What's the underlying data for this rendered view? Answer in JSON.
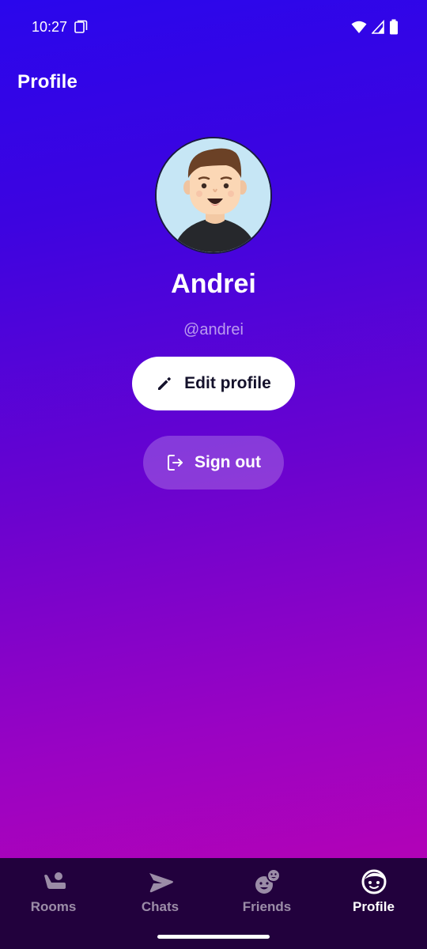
{
  "status_bar": {
    "time": "10:27"
  },
  "header": {
    "title": "Profile"
  },
  "profile": {
    "name": "Andrei",
    "handle": "@andrei"
  },
  "actions": {
    "edit_label": "Edit profile",
    "signout_label": "Sign out"
  },
  "nav": {
    "items": [
      {
        "label": "Rooms",
        "icon": "rooms-icon",
        "active": false
      },
      {
        "label": "Chats",
        "icon": "chats-icon",
        "active": false
      },
      {
        "label": "Friends",
        "icon": "friends-icon",
        "active": false
      },
      {
        "label": "Profile",
        "icon": "profile-icon",
        "active": true
      }
    ]
  },
  "colors": {
    "nav_background": "#22013d",
    "gradient_top": "#2a06ec",
    "gradient_bottom": "#bf02b0",
    "edit_button_bg": "#ffffff"
  }
}
